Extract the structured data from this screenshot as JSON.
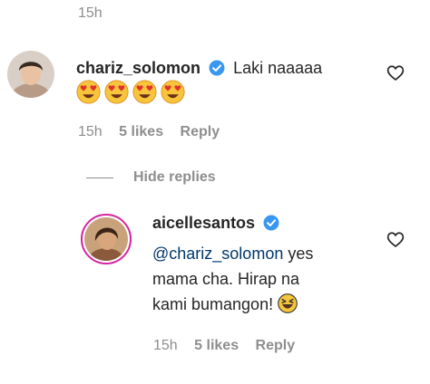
{
  "top_meta": {
    "time": "15h"
  },
  "comment": {
    "username": "chariz_solomon",
    "text": "Laki naaaaa",
    "emoji_count": 4,
    "time": "15h",
    "likes": "5 likes",
    "reply": "Reply"
  },
  "hide_replies": "Hide replies",
  "reply_comment": {
    "username": "aicellesantos",
    "mention": "@chariz_solomon",
    "text_line1": " yes",
    "text_line2": "mama cha. Hirap na",
    "text_line3": "kami bumangon!",
    "time": "15h",
    "likes": "5 likes",
    "reply": "Reply"
  },
  "colors": {
    "verified": "#3897f0",
    "meta": "#8e8e8e",
    "mention": "#00376b"
  }
}
